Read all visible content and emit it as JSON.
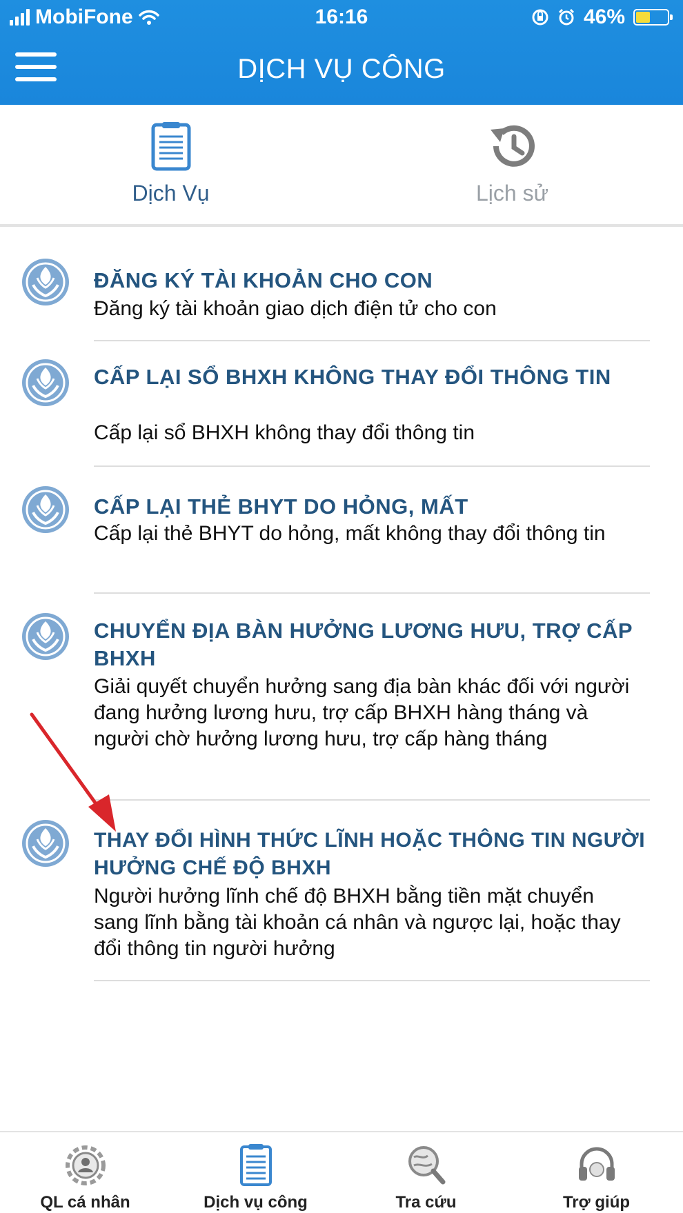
{
  "status_bar": {
    "carrier": "MobiFone",
    "time": "16:16",
    "battery": "46%",
    "battery_level": 0.46
  },
  "header": {
    "title": "DỊCH VỤ CÔNG",
    "menu_icon": "hamburger-menu-icon"
  },
  "top_tabs": [
    {
      "label": "Dịch Vụ",
      "icon": "clipboard-icon",
      "active": true
    },
    {
      "label": "Lịch sử",
      "icon": "history-icon",
      "active": false
    }
  ],
  "services": [
    {
      "title": "ĐĂNG KÝ TÀI KHOẢN CHO CON",
      "description": "Đăng ký tài khoản giao dịch điện tử cho con"
    },
    {
      "title": "CẤP LẠI SỔ BHXH KHÔNG THAY ĐỔI THÔNG TIN",
      "description": "Cấp lại sổ BHXH không thay đổi thông tin"
    },
    {
      "title": "CẤP LẠI THẺ BHYT DO HỎNG, MẤT",
      "description": "Cấp lại thẻ BHYT do hỏng, mất không thay đổi thông tin"
    },
    {
      "title": "CHUYỂN ĐỊA BÀN HƯỞNG LƯƠNG HƯU, TRỢ CẤP BHXH",
      "description": "Giải quyết chuyển hưởng sang địa bàn khác đối với người đang hưởng lương hưu, trợ cấp BHXH hàng tháng và người chờ hưởng lương hưu, trợ cấp hàng tháng"
    },
    {
      "title": "THAY ĐỔI HÌNH THỨC LĨNH HOẶC THÔNG TIN NGƯỜI HƯỞNG CHẾ ĐỘ BHXH",
      "description": "Người hưởng lĩnh chế độ BHXH bằng tiền mặt chuyển sang lĩnh bằng tài khoản cá nhân và ngược lại, hoặc thay đổi thông tin người hưởng"
    }
  ],
  "bottom_nav": [
    {
      "label": "QL cá nhân",
      "icon": "personal-settings-icon"
    },
    {
      "label": "Dịch vụ công",
      "icon": "clipboard-icon",
      "active": true
    },
    {
      "label": "Tra cứu",
      "icon": "search-globe-icon"
    },
    {
      "label": "Trợ giúp",
      "icon": "headset-icon"
    }
  ],
  "colors": {
    "header_blue": "#1f8fe0",
    "title_blue": "#24557f",
    "arrow_red": "#d9262b"
  }
}
